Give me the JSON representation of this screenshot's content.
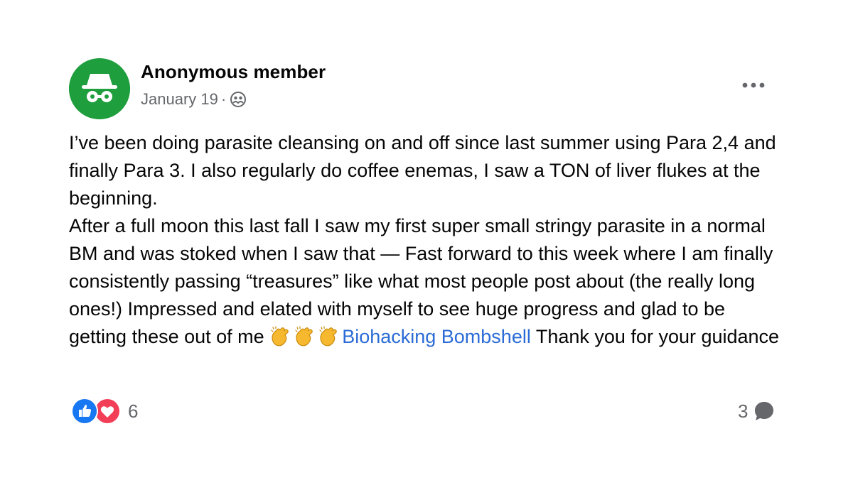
{
  "post": {
    "author": "Anonymous member",
    "date": "January 19",
    "date_separator": "·",
    "audience_icon": "group-icon",
    "more_icon": "more-options-icon",
    "body": {
      "para1": "I’ve been doing parasite cleansing on and off since last summer using Para 2,4 and finally Para 3. I also regularly do coffee enemas, I saw a TON of liver flukes at the beginning.",
      "para2_text": "After a full moon this last fall I saw my first super small stringy parasite in a normal BM and was stoked when I saw that — Fast forward to this week where I am finally consistently passing “treasures” like what most people post about (the really long ones!) Impressed and elated with myself to see huge progress and glad to be getting these out of me ",
      "emoji": [
        "clapping-hands-icon",
        "clapping-hands-icon",
        "clapping-hands-icon"
      ],
      "mention": "Biohacking Bombshell",
      "para2_end": " Thank you for your guidance"
    },
    "reactions": {
      "icons": [
        "like-icon",
        "love-icon"
      ],
      "count": "6"
    },
    "comments": {
      "count": "3",
      "icon": "comment-icon"
    },
    "colors": {
      "avatar_bg": "#1e9e3c",
      "mention": "#2a6bd6",
      "like": "#1877f2",
      "love": "#f33e58",
      "muted": "#65676b"
    }
  }
}
